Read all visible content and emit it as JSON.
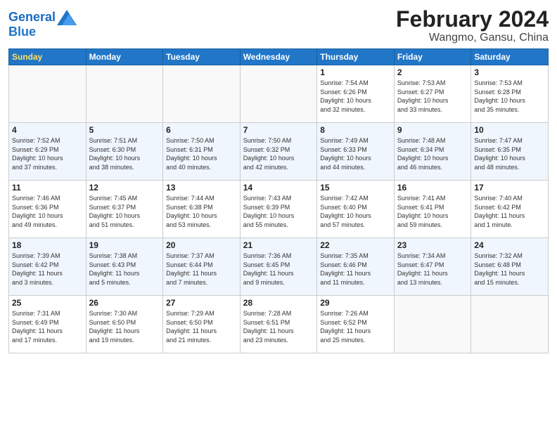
{
  "header": {
    "logo_line1": "General",
    "logo_line2": "Blue",
    "title": "February 2024",
    "subtitle": "Wangmo, Gansu, China"
  },
  "days_of_week": [
    "Sunday",
    "Monday",
    "Tuesday",
    "Wednesday",
    "Thursday",
    "Friday",
    "Saturday"
  ],
  "weeks": [
    [
      {
        "num": "",
        "info": ""
      },
      {
        "num": "",
        "info": ""
      },
      {
        "num": "",
        "info": ""
      },
      {
        "num": "",
        "info": ""
      },
      {
        "num": "1",
        "info": "Sunrise: 7:54 AM\nSunset: 6:26 PM\nDaylight: 10 hours\nand 32 minutes."
      },
      {
        "num": "2",
        "info": "Sunrise: 7:53 AM\nSunset: 6:27 PM\nDaylight: 10 hours\nand 33 minutes."
      },
      {
        "num": "3",
        "info": "Sunrise: 7:53 AM\nSunset: 6:28 PM\nDaylight: 10 hours\nand 35 minutes."
      }
    ],
    [
      {
        "num": "4",
        "info": "Sunrise: 7:52 AM\nSunset: 6:29 PM\nDaylight: 10 hours\nand 37 minutes."
      },
      {
        "num": "5",
        "info": "Sunrise: 7:51 AM\nSunset: 6:30 PM\nDaylight: 10 hours\nand 38 minutes."
      },
      {
        "num": "6",
        "info": "Sunrise: 7:50 AM\nSunset: 6:31 PM\nDaylight: 10 hours\nand 40 minutes."
      },
      {
        "num": "7",
        "info": "Sunrise: 7:50 AM\nSunset: 6:32 PM\nDaylight: 10 hours\nand 42 minutes."
      },
      {
        "num": "8",
        "info": "Sunrise: 7:49 AM\nSunset: 6:33 PM\nDaylight: 10 hours\nand 44 minutes."
      },
      {
        "num": "9",
        "info": "Sunrise: 7:48 AM\nSunset: 6:34 PM\nDaylight: 10 hours\nand 46 minutes."
      },
      {
        "num": "10",
        "info": "Sunrise: 7:47 AM\nSunset: 6:35 PM\nDaylight: 10 hours\nand 48 minutes."
      }
    ],
    [
      {
        "num": "11",
        "info": "Sunrise: 7:46 AM\nSunset: 6:36 PM\nDaylight: 10 hours\nand 49 minutes."
      },
      {
        "num": "12",
        "info": "Sunrise: 7:45 AM\nSunset: 6:37 PM\nDaylight: 10 hours\nand 51 minutes."
      },
      {
        "num": "13",
        "info": "Sunrise: 7:44 AM\nSunset: 6:38 PM\nDaylight: 10 hours\nand 53 minutes."
      },
      {
        "num": "14",
        "info": "Sunrise: 7:43 AM\nSunset: 6:39 PM\nDaylight: 10 hours\nand 55 minutes."
      },
      {
        "num": "15",
        "info": "Sunrise: 7:42 AM\nSunset: 6:40 PM\nDaylight: 10 hours\nand 57 minutes."
      },
      {
        "num": "16",
        "info": "Sunrise: 7:41 AM\nSunset: 6:41 PM\nDaylight: 10 hours\nand 59 minutes."
      },
      {
        "num": "17",
        "info": "Sunrise: 7:40 AM\nSunset: 6:42 PM\nDaylight: 11 hours\nand 1 minute."
      }
    ],
    [
      {
        "num": "18",
        "info": "Sunrise: 7:39 AM\nSunset: 6:42 PM\nDaylight: 11 hours\nand 3 minutes."
      },
      {
        "num": "19",
        "info": "Sunrise: 7:38 AM\nSunset: 6:43 PM\nDaylight: 11 hours\nand 5 minutes."
      },
      {
        "num": "20",
        "info": "Sunrise: 7:37 AM\nSunset: 6:44 PM\nDaylight: 11 hours\nand 7 minutes."
      },
      {
        "num": "21",
        "info": "Sunrise: 7:36 AM\nSunset: 6:45 PM\nDaylight: 11 hours\nand 9 minutes."
      },
      {
        "num": "22",
        "info": "Sunrise: 7:35 AM\nSunset: 6:46 PM\nDaylight: 11 hours\nand 11 minutes."
      },
      {
        "num": "23",
        "info": "Sunrise: 7:34 AM\nSunset: 6:47 PM\nDaylight: 11 hours\nand 13 minutes."
      },
      {
        "num": "24",
        "info": "Sunrise: 7:32 AM\nSunset: 6:48 PM\nDaylight: 11 hours\nand 15 minutes."
      }
    ],
    [
      {
        "num": "25",
        "info": "Sunrise: 7:31 AM\nSunset: 6:49 PM\nDaylight: 11 hours\nand 17 minutes."
      },
      {
        "num": "26",
        "info": "Sunrise: 7:30 AM\nSunset: 6:50 PM\nDaylight: 11 hours\nand 19 minutes."
      },
      {
        "num": "27",
        "info": "Sunrise: 7:29 AM\nSunset: 6:50 PM\nDaylight: 11 hours\nand 21 minutes."
      },
      {
        "num": "28",
        "info": "Sunrise: 7:28 AM\nSunset: 6:51 PM\nDaylight: 11 hours\nand 23 minutes."
      },
      {
        "num": "29",
        "info": "Sunrise: 7:26 AM\nSunset: 6:52 PM\nDaylight: 11 hours\nand 25 minutes."
      },
      {
        "num": "",
        "info": ""
      },
      {
        "num": "",
        "info": ""
      }
    ]
  ]
}
